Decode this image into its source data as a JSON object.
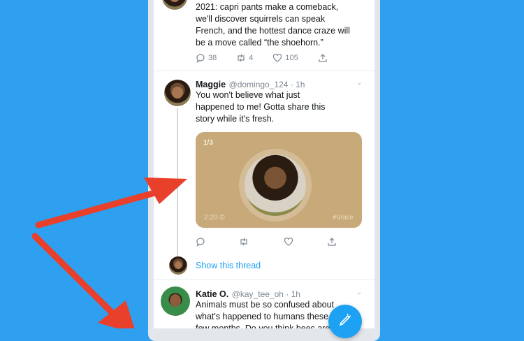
{
  "tweet1": {
    "text": "2021: capri pants make a comeback,\nwe'll discover squirrels can speak\nFrench, and the hottest dance craze will\nbe a move called “the shoehorn.”",
    "replies": "38",
    "retweets": "4",
    "likes": "105"
  },
  "tweet2": {
    "name": "Maggie",
    "handle": "@domingo_124 · 1h",
    "text": "You won't believe what just\nhappened to me! Gotta share this\nstory while it's fresh.",
    "voice_card": {
      "count": "1/3",
      "duration": "2:20 ©",
      "tag": "#Voice"
    },
    "show_thread": "Show this thread"
  },
  "tweet3": {
    "name": "Katie O.",
    "handle": "@kay_tee_oh · 1h",
    "text": "Animals must be so confused about\nwhat's happened to humans these\nfew months. Do you think bees are"
  },
  "colors": {
    "background": "#2f9ff0",
    "accent": "#1da1f2",
    "voice_card": "#c8aa7a",
    "annotation_arrow": "#e8402b"
  }
}
